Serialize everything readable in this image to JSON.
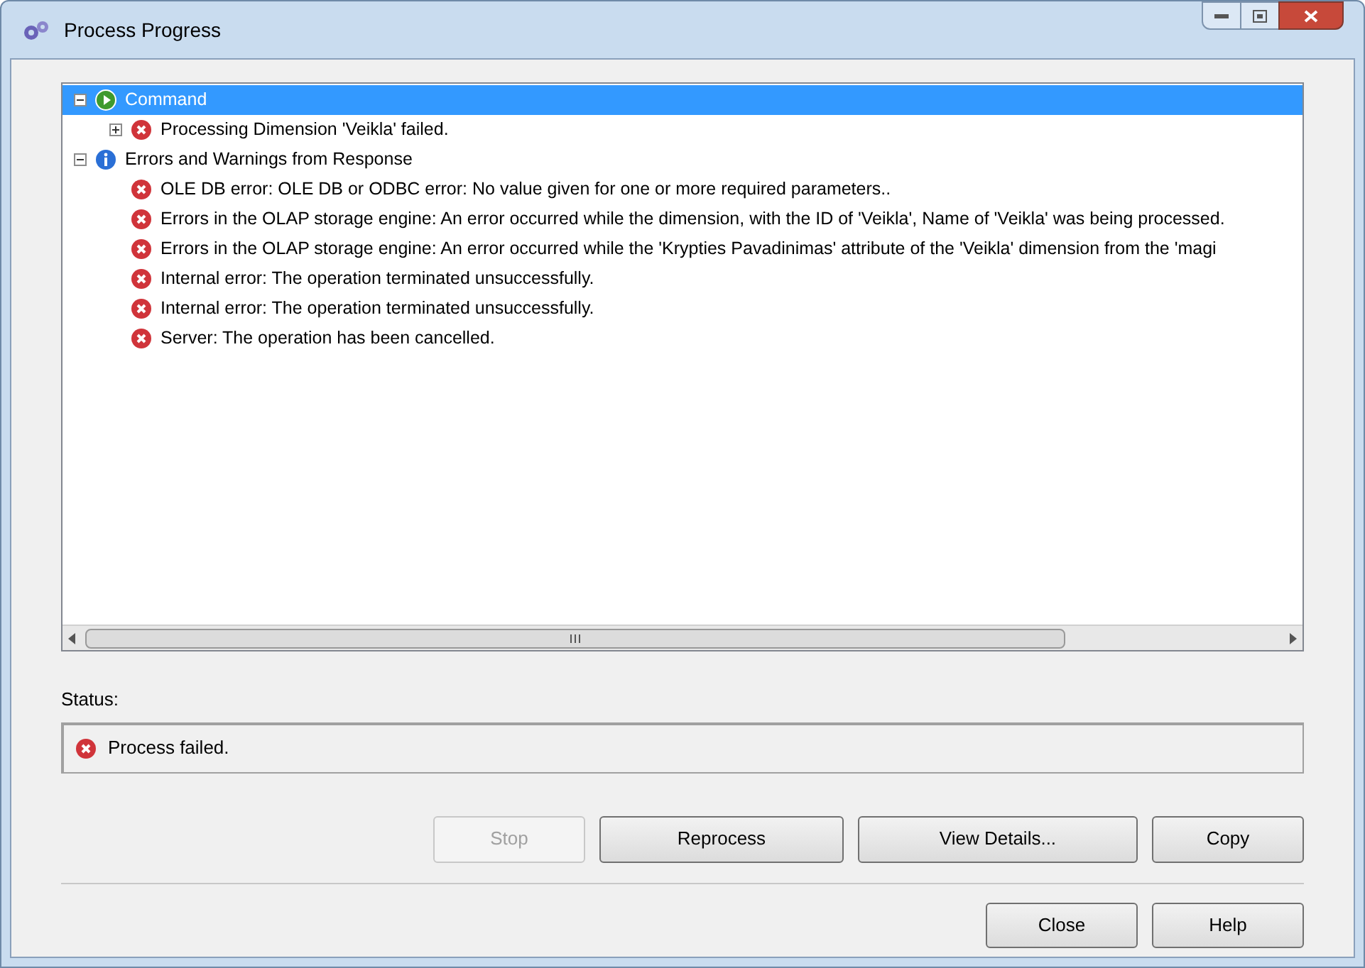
{
  "window": {
    "title": "Process Progress"
  },
  "tree": [
    {
      "kind": "run",
      "label": "Command",
      "selected": true,
      "expanded": true,
      "children": [
        {
          "kind": "error",
          "label": "Processing Dimension 'Veikla' failed.",
          "selected": false,
          "expanded": false
        }
      ]
    },
    {
      "kind": "info",
      "label": "Errors and Warnings from Response",
      "selected": false,
      "expanded": true,
      "children": [
        {
          "kind": "error",
          "label": "OLE DB error: OLE DB or ODBC error: No value given for one or more required parameters..",
          "selected": false
        },
        {
          "kind": "error",
          "label": "Errors in the OLAP storage engine: An error occurred while the dimension, with the ID of 'Veikla', Name of 'Veikla' was being processed.",
          "selected": false
        },
        {
          "kind": "error",
          "label": "Errors in the OLAP storage engine: An error occurred while the 'Krypties Pavadinimas' attribute of the 'Veikla' dimension from the 'magi",
          "selected": false
        },
        {
          "kind": "error",
          "label": "Internal error: The operation terminated unsuccessfully.",
          "selected": false
        },
        {
          "kind": "error",
          "label": "Internal error: The operation terminated unsuccessfully.",
          "selected": false
        },
        {
          "kind": "error",
          "label": "Server: The operation has been cancelled.",
          "selected": false
        }
      ]
    }
  ],
  "status": {
    "label": "Status:",
    "kind": "error",
    "text": "Process failed."
  },
  "action_buttons": [
    {
      "label": "Stop",
      "disabled": true
    },
    {
      "label": "Reprocess",
      "disabled": false
    },
    {
      "label": "View Details...",
      "disabled": false
    },
    {
      "label": "Copy",
      "disabled": false
    }
  ],
  "dialog_buttons": [
    {
      "label": "Close",
      "disabled": false
    },
    {
      "label": "Help",
      "disabled": false
    }
  ]
}
